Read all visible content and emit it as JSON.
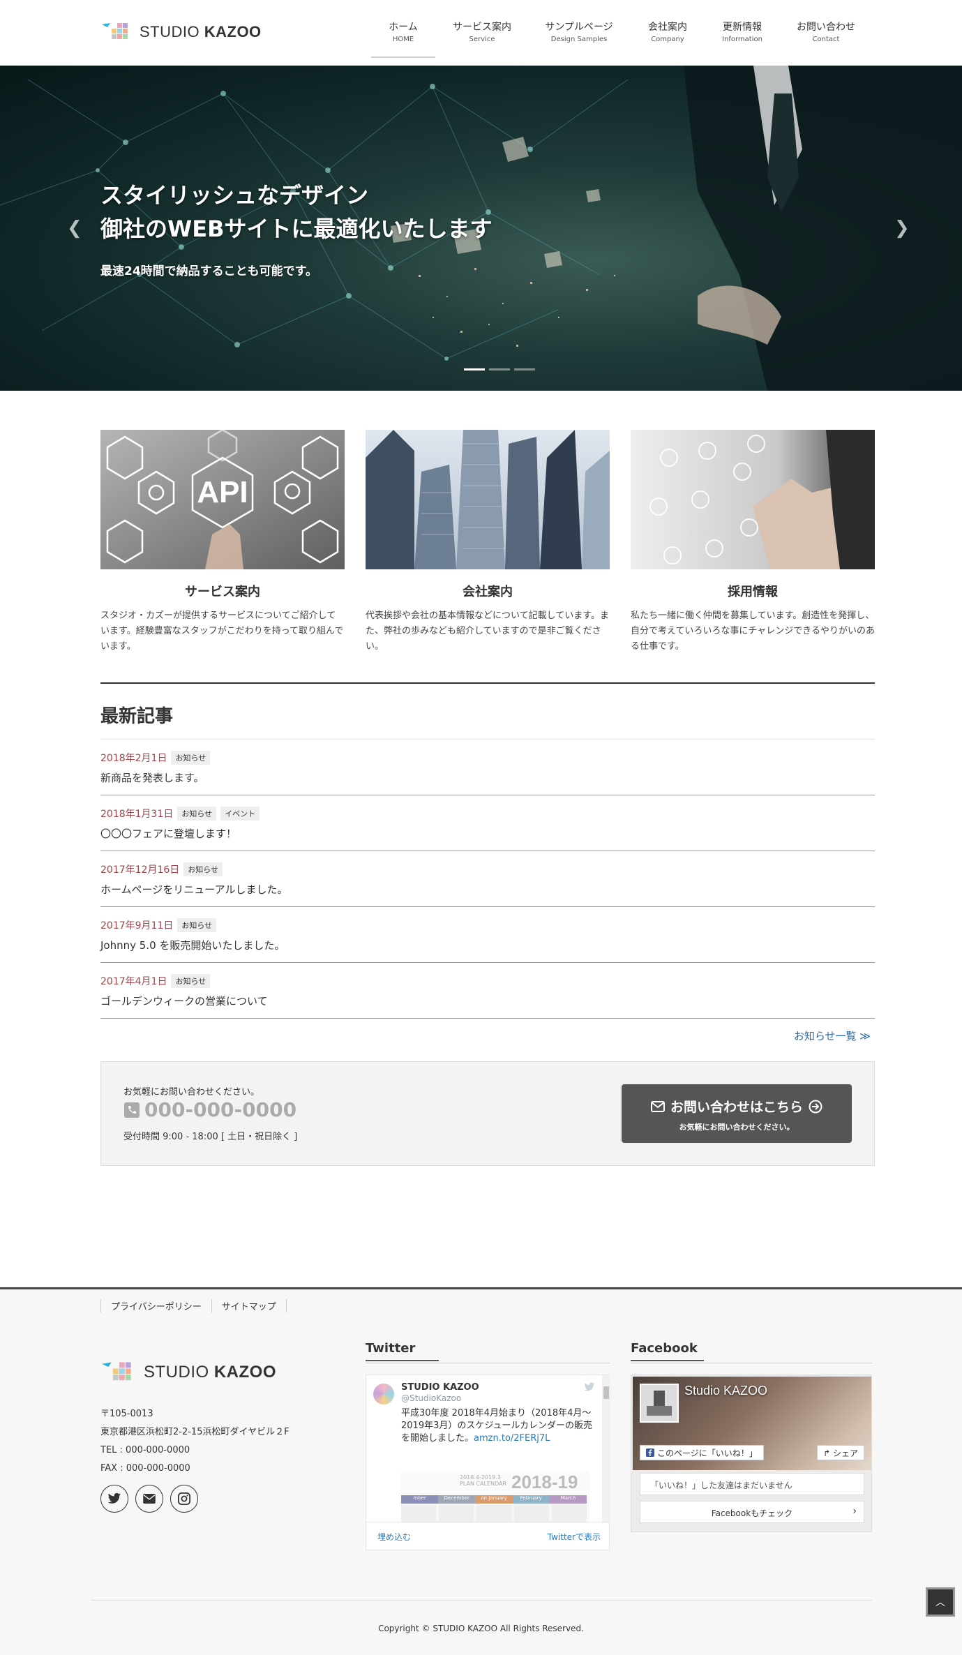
{
  "header": {
    "logo": {
      "text_regular": "STUDIO ",
      "text_bold": "KAZOO"
    },
    "nav": [
      {
        "jp": "ホーム",
        "en": "HOME"
      },
      {
        "jp": "サービス案内",
        "en": "Service"
      },
      {
        "jp": "サンプルページ",
        "en": "Design Samples"
      },
      {
        "jp": "会社案内",
        "en": "Company"
      },
      {
        "jp": "更新情報",
        "en": "Information"
      },
      {
        "jp": "お問い合わせ",
        "en": "Contact"
      }
    ]
  },
  "hero": {
    "title_line1": "スタイリッシュなデザイン",
    "title_line2": "御社のWEBサイトに最適化いたします",
    "subtitle": "最速24時間で納品することも可能です。",
    "prev": "❮",
    "next": "❯",
    "slides": 3,
    "active_slide": 1
  },
  "cards": [
    {
      "title": "サービス案内",
      "text": "スタジオ・カズーが提供するサービスについてご紹介しています。経験豊富なスタッフがこだわりを持って取り組んでいます。",
      "image_text": "API"
    },
    {
      "title": "会社案内",
      "text": "代表挨拶や会社の基本情報などについて記載しています。また、弊社の歩みなども紹介していますので是非ご覧ください。"
    },
    {
      "title": "採用情報",
      "text": "私たち一緒に働く仲間を募集しています。創造性を発揮し、自分で考えていろいろな事にチャレンジできるやりがいのある仕事です。"
    }
  ],
  "news": {
    "heading": "最新記事",
    "items": [
      {
        "date": "2018年2月1日",
        "tags": [
          "お知らせ"
        ],
        "title": "新商品を発表します。"
      },
      {
        "date": "2018年1月31日",
        "tags": [
          "お知らせ",
          "イベント"
        ],
        "title": "〇〇〇フェアに登壇します！"
      },
      {
        "date": "2017年12月16日",
        "tags": [
          "お知らせ"
        ],
        "title": "ホームページをリニューアルしました。"
      },
      {
        "date": "2017年9月11日",
        "tags": [
          "お知らせ"
        ],
        "title": "Johnny 5.0 を販売開始いたしました。"
      },
      {
        "date": "2017年4月1日",
        "tags": [
          "お知らせ"
        ],
        "title": "ゴールデンウィークの営業について"
      }
    ],
    "more": "お知らせ一覧 ≫"
  },
  "contact": {
    "lead": "お気軽にお問い合わせください。",
    "phone": "000-000-0000",
    "hours": "受付時間 9:00 - 18:00 [ 土日・祝日除く ]",
    "button_main": "お問い合わせはこちら",
    "button_sub": "お気軽にお問い合わせください。"
  },
  "footer": {
    "links": [
      "プライバシーポリシー",
      "サイトマップ"
    ],
    "logo": {
      "text_regular": "STUDIO ",
      "text_bold": "KAZOO"
    },
    "address": [
      "〒105-0013",
      "東京都港区浜松町2-2-15浜松町ダイヤビル２F",
      "TEL : 000-000-0000",
      "FAX : 000-000-0000"
    ],
    "twitter": {
      "title": "Twitter",
      "name": "STUDIO KAZOO",
      "handle": "@StudioKazoo",
      "text": "平成30年度 2018年4月始まり（2018年4月〜2019年3月）のスケジュールカレンダーの販売を開始しました。",
      "link": "amzn.to/2FERj7L",
      "calendar_year": "2018-19",
      "calendar_caption": "2018.4-2019.3",
      "calendar_subcaption": "PLAN CALENDAR",
      "calendar_months": [
        "mber",
        "December",
        "on January",
        "February",
        "March"
      ],
      "embed": "埋め込む",
      "view": "Twitterで表示"
    },
    "facebook": {
      "title": "Facebook",
      "page_name": "Studio KAZOO",
      "like": "このページに「いいね！」",
      "share": "シェア",
      "friends": "「いいね！」した友達はまだいません",
      "check": "Facebookもチェック"
    },
    "copyright": "Copyright © STUDIO KAZOO All Rights Reserved."
  }
}
